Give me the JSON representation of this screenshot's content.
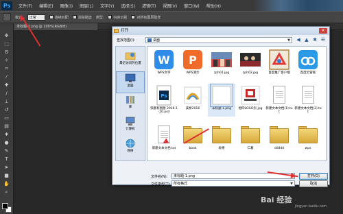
{
  "app": {
    "logo": "Ps"
  },
  "menu": [
    "文件(F)",
    "编辑(E)",
    "图像(I)",
    "图层(L)",
    "文字(Y)",
    "选择(S)",
    "滤镜(T)",
    "视图(V)",
    "窗口(W)",
    "帮助(H)"
  ],
  "options": {
    "mode_label": "模式:",
    "mode_value": "正常",
    "contiguous": "连续匹配",
    "aa": "消除锯齿",
    "type_label": "类型:",
    "content": "内容识别",
    "sample": "对所有图层取样"
  },
  "document_tab": "未标题-1.png @ 100%(RGB/8)",
  "dialog": {
    "title": "打开",
    "lookin_label": "查找范围(I):",
    "lookin_value": "桌面",
    "places": [
      {
        "label": "最近访问的位置",
        "icon": "recent-icon"
      },
      {
        "label": "桌面",
        "icon": "desktop-icon"
      },
      {
        "label": "库",
        "icon": "library-icon"
      },
      {
        "label": "计算机",
        "icon": "computer-icon"
      },
      {
        "label": "网络",
        "icon": "network-icon"
      }
    ],
    "files": [
      {
        "label": "WPS文字",
        "kind": "wps-w"
      },
      {
        "label": "WPS演示",
        "kind": "wps-p"
      },
      {
        "label": "zph01.jpg",
        "kind": "photo1"
      },
      {
        "label": "zph02.jpg",
        "kind": "photo2"
      },
      {
        "label": "百度推广客户端",
        "kind": "baidu-tg"
      },
      {
        "label": "百度云管家",
        "kind": "baidu-yun"
      },
      {
        "label": "快葛有图图 2016-1-20.psd",
        "kind": "psd"
      },
      {
        "label": "美桥2016",
        "kind": "meiqiao"
      },
      {
        "label": "未标题-1.png",
        "kind": "blank-png"
      },
      {
        "label": "相印LOGO页.jpg",
        "kind": "logo"
      },
      {
        "label": "新建文本文档(1).txt",
        "kind": "txt"
      },
      {
        "label": "新建文本文档(2).txt",
        "kind": "txt"
      },
      {
        "label": "新建文本文档.txt",
        "kind": "txt"
      },
      {
        "label": "book",
        "kind": "folder"
      },
      {
        "label": "表格",
        "kind": "folder"
      },
      {
        "label": "仁葛",
        "kind": "folder"
      },
      {
        "label": "ddddd",
        "kind": "folder"
      },
      {
        "label": "wps",
        "kind": "folder"
      }
    ],
    "filename_label": "文件名(N):",
    "filename_value": "未标题-1.png",
    "filetype_label": "文件类型(T):",
    "filetype_value": "所有格式",
    "open_button": "打开(O)",
    "cancel_button": "取消"
  },
  "watermark": {
    "text": "Bai 经验",
    "sub": "jingyan.baidu.com"
  }
}
